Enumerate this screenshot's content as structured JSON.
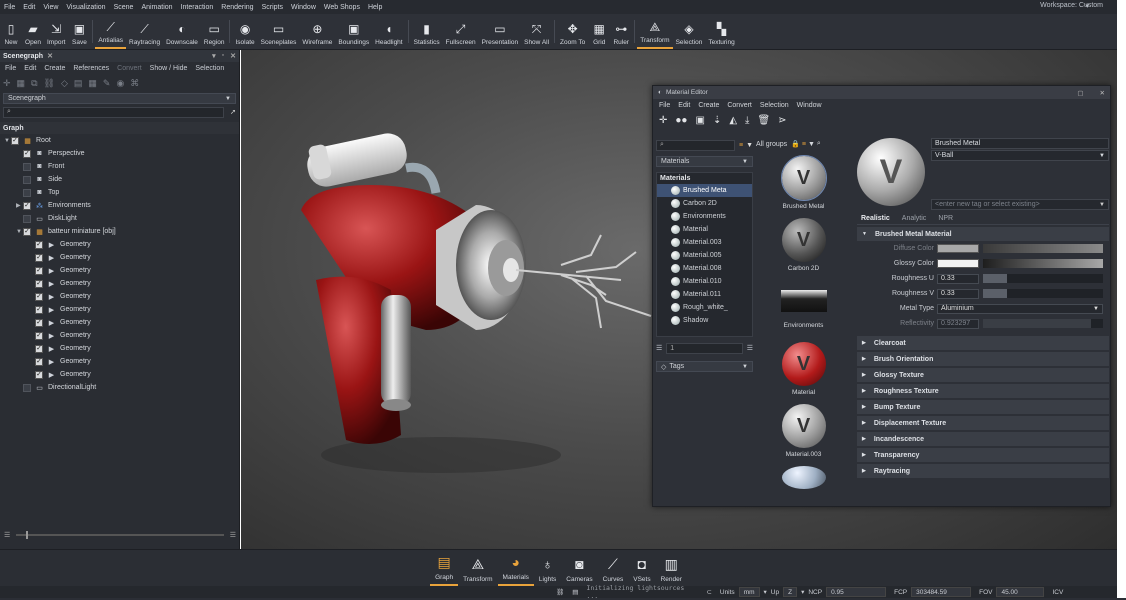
{
  "menu": [
    "File",
    "Edit",
    "View",
    "Visualization",
    "Scene",
    "Animation",
    "Interaction",
    "Rendering",
    "Scripts",
    "Window",
    "Web Shops",
    "Help"
  ],
  "workspace": "Workspace: Custom",
  "toolbar": [
    {
      "label": "New",
      "icon": "new-file-icon",
      "glyph": "▯"
    },
    {
      "label": "Open",
      "icon": "folder-icon",
      "glyph": "▰"
    },
    {
      "label": "Import",
      "icon": "import-icon",
      "glyph": "⇲"
    },
    {
      "label": "Save",
      "icon": "save-icon",
      "glyph": "▣"
    },
    {
      "label": "Antialias",
      "icon": "antialias-icon",
      "glyph": "⟋"
    },
    {
      "label": "Raytracing",
      "icon": "raytracing-icon",
      "glyph": "⟋"
    },
    {
      "label": "Downscale",
      "icon": "downscale-icon",
      "glyph": "◐"
    },
    {
      "label": "Region",
      "icon": "region-icon",
      "glyph": "▭"
    },
    {
      "label": "Isolate",
      "icon": "eye-icon",
      "glyph": "◉"
    },
    {
      "label": "Sceneplates",
      "icon": "sceneplates-icon",
      "glyph": "▭"
    },
    {
      "label": "Wireframe",
      "icon": "globe-icon",
      "glyph": "⊕"
    },
    {
      "label": "Boundings",
      "icon": "boundings-icon",
      "glyph": "▣"
    },
    {
      "label": "Headlight",
      "icon": "headlight-icon",
      "glyph": "◖"
    },
    {
      "label": "Statistics",
      "icon": "statistics-icon",
      "glyph": "▮"
    },
    {
      "label": "Fullscreen",
      "icon": "fullscreen-icon",
      "glyph": "⤢"
    },
    {
      "label": "Presentation",
      "icon": "presentation-icon",
      "glyph": "▭"
    },
    {
      "label": "Show All",
      "icon": "show-all-icon",
      "glyph": "⤧"
    },
    {
      "label": "Zoom To",
      "icon": "zoom-to-icon",
      "glyph": "✥"
    },
    {
      "label": "Grid",
      "icon": "grid-icon",
      "glyph": "▦"
    },
    {
      "label": "Ruler",
      "icon": "ruler-icon",
      "glyph": "⊶"
    },
    {
      "label": "Transform",
      "icon": "transform-icon",
      "glyph": "⟁"
    },
    {
      "label": "Selection",
      "icon": "selection-icon",
      "glyph": "◈"
    },
    {
      "label": "Texturing",
      "icon": "texturing-icon",
      "glyph": "▚"
    }
  ],
  "scenegraph": {
    "title": "Scenegraph",
    "menu": [
      "File",
      "Edit",
      "Create",
      "References",
      "Convert",
      "Show / Hide",
      "Selection"
    ],
    "combo": "Scenegraph",
    "graph_header": "Graph",
    "items": [
      {
        "label": "Root",
        "indent": 0,
        "chk": "on",
        "icon": "group-icon"
      },
      {
        "label": "Perspective",
        "indent": 1,
        "chk": "on",
        "icon": "camera-icon"
      },
      {
        "label": "Front",
        "indent": 1,
        "chk": "off",
        "icon": "camera-icon"
      },
      {
        "label": "Side",
        "indent": 1,
        "chk": "off",
        "icon": "camera-icon"
      },
      {
        "label": "Top",
        "indent": 1,
        "chk": "off",
        "icon": "camera-icon"
      },
      {
        "label": "Environments",
        "indent": 1,
        "chk": "on",
        "icon": "environment-icon"
      },
      {
        "label": "DiskLight",
        "indent": 1,
        "chk": "off",
        "icon": "light-icon"
      },
      {
        "label": "batteur miniature [obj]",
        "indent": 1,
        "chk": "on",
        "icon": "group-icon"
      },
      {
        "label": "Geometry",
        "indent": 2,
        "chk": "on",
        "icon": "geometry-icon"
      },
      {
        "label": "Geometry",
        "indent": 2,
        "chk": "on",
        "icon": "geometry-icon"
      },
      {
        "label": "Geometry",
        "indent": 2,
        "chk": "on",
        "icon": "geometry-icon"
      },
      {
        "label": "Geometry",
        "indent": 2,
        "chk": "on",
        "icon": "geometry-icon"
      },
      {
        "label": "Geometry",
        "indent": 2,
        "chk": "on",
        "icon": "geometry-icon"
      },
      {
        "label": "Geometry",
        "indent": 2,
        "chk": "on",
        "icon": "geometry-icon"
      },
      {
        "label": "Geometry",
        "indent": 2,
        "chk": "on",
        "icon": "geometry-icon"
      },
      {
        "label": "Geometry",
        "indent": 2,
        "chk": "on",
        "icon": "geometry-icon"
      },
      {
        "label": "Geometry",
        "indent": 2,
        "chk": "on",
        "icon": "geometry-icon"
      },
      {
        "label": "Geometry",
        "indent": 2,
        "chk": "on",
        "icon": "geometry-icon"
      },
      {
        "label": "Geometry",
        "indent": 2,
        "chk": "on",
        "icon": "geometry-icon"
      },
      {
        "label": "DirectionalLight",
        "indent": 1,
        "chk": "off",
        "icon": "light-icon"
      }
    ]
  },
  "material_editor": {
    "title": "Material Editor",
    "menu": [
      "File",
      "Edit",
      "Create",
      "Convert",
      "Selection",
      "Window"
    ],
    "filter_combo": "Materials",
    "all_groups": "All groups",
    "list_header": "Materials",
    "materials": [
      "Brushed Meta",
      "Carbon 2D",
      "Environments",
      "Material",
      "Material.003",
      "Material.005",
      "Material.008",
      "Material.010",
      "Material.011",
      "Rough_white_",
      "Shadow"
    ],
    "tags_combo": "Tags",
    "list_field": "1",
    "thumbnails": [
      "Brushed Metal",
      "Carbon 2D",
      "Environments",
      "Material",
      "Material.003"
    ],
    "name_field": "Brushed Metal",
    "type_field": "V-Ball",
    "tag_placeholder": "<enter new tag or select existing>",
    "tabs": [
      "Realistic",
      "Analytic",
      "NPR"
    ],
    "section": "Brushed Metal Material",
    "props": {
      "diffuse": "Diffuse Color",
      "glossy": "Glossy Color",
      "rough_u_label": "Roughness U",
      "rough_u": "0.33",
      "rough_v_label": "Roughness V",
      "rough_v": "0.33",
      "metal_type_label": "Metal Type",
      "metal_type": "Aluminium",
      "reflectivity_label": "Reflectivity",
      "reflectivity": "0.923297"
    },
    "sections": [
      "Clearcoat",
      "Brush Orientation",
      "Glossy Texture",
      "Roughness Texture",
      "Bump Texture",
      "Displacement Texture",
      "Incandescence",
      "Transparency",
      "Raytracing"
    ]
  },
  "bottom_tools": [
    {
      "label": "Graph",
      "icon": "graph-icon",
      "glyph": "▤"
    },
    {
      "label": "Transform",
      "icon": "transform-icon",
      "glyph": "⟁"
    },
    {
      "label": "Materials",
      "icon": "materials-icon",
      "glyph": "◕"
    },
    {
      "label": "Lights",
      "icon": "lightbulb-icon",
      "glyph": "♁"
    },
    {
      "label": "Cameras",
      "icon": "camera-icon",
      "glyph": "◙"
    },
    {
      "label": "Curves",
      "icon": "curves-icon",
      "glyph": "⟋"
    },
    {
      "label": "VSets",
      "icon": "vsets-icon",
      "glyph": "◘"
    },
    {
      "label": "Render",
      "icon": "render-icon",
      "glyph": "▥"
    }
  ],
  "status": {
    "message": "Initializing lightsources ...",
    "units_label": "Units",
    "units": "mm",
    "up_label": "Up",
    "up": "Z",
    "ncp_label": "NCP",
    "ncp": "0.95",
    "fcp_label": "FCP",
    "fcp": "303484.59",
    "fov_label": "FOV",
    "fov": "45.00",
    "icv": "ICV"
  }
}
